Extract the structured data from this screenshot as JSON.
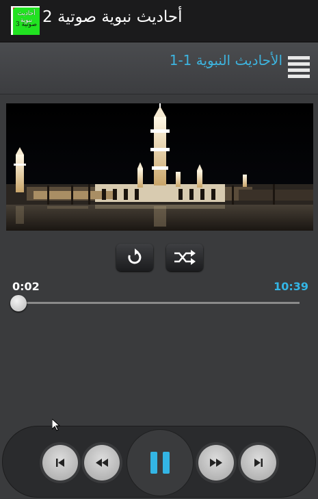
{
  "app": {
    "title": "أحاديث نبوية صوتية 2",
    "icon_line1": "أحاديث نبوية",
    "icon_line2": "صوتية 3"
  },
  "header": {
    "playlist_title": "1-الأحاديث النبوية  1",
    "menu_icon": "hamburger-icon"
  },
  "controls": {
    "repeat_icon": "repeat-icon",
    "shuffle_icon": "shuffle-icon"
  },
  "progress": {
    "current_time": "0:02",
    "total_time": "10:39",
    "fraction": 0.003
  },
  "player": {
    "buttons": [
      "previous-icon",
      "rewind-icon",
      "pause-icon",
      "fast-forward-icon",
      "next-icon"
    ]
  },
  "colors": {
    "accent": "#33b5e5",
    "background": "#3a3b3d",
    "titlebar": "#1b1b1c",
    "icon_green": "#21e321"
  }
}
